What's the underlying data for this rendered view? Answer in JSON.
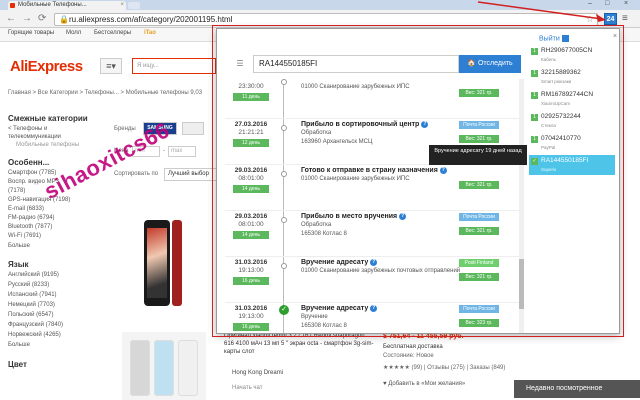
{
  "browser": {
    "tab_title": "Мобильные Телефоны...",
    "tab_close": "×",
    "url": "ru.aliexpress.com/af/category/202001195.html",
    "lock_icon": "lock-icon",
    "back": "←",
    "forward": "→",
    "reload": "⟳",
    "star": "☆",
    "extension_badge": "24",
    "menu": "≡",
    "minimize": "–",
    "maximize": "□",
    "close": "×"
  },
  "bookmarks": [
    "Горящие товары",
    "Молл",
    "Бестселлеры",
    "iTao"
  ],
  "ae": {
    "logo": "AliExpress",
    "menu_glyph": "≡▾",
    "search_placeholder": "Я ищу...",
    "breadcrumb": "Главная > Все Категории > Телефоны... > Мобильные телефоны 9,03",
    "related_title": "Смежные категории",
    "related_items": [
      "< Телефоны и",
      "телекоммуникации",
      "Мобильные телефоны"
    ],
    "features_title": "Особенн...",
    "features": [
      "Смартфон (7785)",
      "Воспр. видео MP3",
      "(7178)",
      "GPS-навигация (7198)",
      "E-mail (6833)",
      "FM-радио (6794)",
      "Bluetooth (7877)",
      "Wi-Fi (7691)"
    ],
    "more": "Больше",
    "lang_title": "Язык",
    "langs": [
      "Английский (9195)",
      "Русский (8233)",
      "Испанский (7941)",
      "Немецкий (7703)",
      "Польский (6547)",
      "Французский (7840)",
      "Норвежский (4265)"
    ],
    "more2": "Больше",
    "color_title": "Цвет",
    "brands_label": "Бренды",
    "brand_chip": "SAMSUNG",
    "price_label": "Цена",
    "price_min": "min",
    "price_dash": "-",
    "price_max": "max",
    "sort_label": "Сортировать по",
    "sort_value": "Лучший выбор",
    "listing": {
      "title": "Оригинал xiaomi redmi 3 2 / 16 г Redmi snapdragon 616 4100 мАч 13 мп 5 \" экран octa - смартфон 3g-sim-карты слот",
      "price": "$ 751,64 - 11 455,59 руб.",
      "shipping": "Бесплатная доставка",
      "condition": "Состояние: Новое",
      "rating": "★★★★★ (99) | Отзывы (275) | Заказы (849)",
      "favorite": "♥ Добавить в «Мои желания»",
      "store": "Hong Kong Dreami",
      "chat": "Начать чат"
    },
    "recent": "Недавно посмотренное"
  },
  "watermark": "sihaoxitcs66",
  "popup": {
    "close": "×",
    "input_value": "RA144550185FI",
    "track_btn": "🏠 Отследить",
    "exit": "Выйти",
    "tooltip": "Вручение адресату 19 дней назад",
    "events": [
      {
        "date": "",
        "time": "23:30:00",
        "days": "11 день",
        "title": "",
        "sub": "01000 Сканирование зарубежных ИПС",
        "addr": "",
        "carrier": "",
        "weight": "Вес: 321 гр.",
        "done": false
      },
      {
        "date": "27.03.2016",
        "time": "21:21:21",
        "days": "12 день",
        "title": "Прибыло в сортировочный центр",
        "sub": "Обработка",
        "addr": "163960 Архангельск МСЦ",
        "carrier": "Почта России",
        "weight": "Вес: 321 гр.",
        "done": false
      },
      {
        "date": "29.03.2016",
        "time": "08:01:00",
        "days": "14 день",
        "title": "Готово к отправке в страну назначения",
        "sub": "01000 Сканирование зарубежных ИПС",
        "addr": "",
        "carrier": "",
        "weight": "Вес: 321 гр.",
        "done": false
      },
      {
        "date": "29.03.2016",
        "time": "08:01:00",
        "days": "14 день",
        "title": "Прибыло в место вручения",
        "sub": "Обработка",
        "addr": "165308 Котлас 8",
        "carrier": "Почта России",
        "weight": "Вес: 321 гр.",
        "done": false
      },
      {
        "date": "31.03.2016",
        "time": "19:13:00",
        "days": "16 день",
        "title": "Вручение адресату",
        "sub": "01000 Сканирование зарубежных почтовых отправлений",
        "addr": "",
        "carrier": "Posti Finland",
        "weight": "Вес: 321 гр.",
        "done": false
      },
      {
        "date": "31.03.2016",
        "time": "19:13:00",
        "days": "16 день",
        "title": "Вручение адресату",
        "sub": "Вручение",
        "addr": "165308 Котлас 8",
        "carrier": "Почта России",
        "weight": "Вес: 323 гр.",
        "done": true
      }
    ],
    "tracks": [
      {
        "num": "1",
        "code": "RH290677005CN",
        "sub": "Кабель"
      },
      {
        "num": "1",
        "code": "32215889362",
        "sub": "Smart рюкзаки"
      },
      {
        "num": "1",
        "code": "RM167892744CN",
        "sub": "XiaomiUpCam"
      },
      {
        "num": "1",
        "code": "02925732244",
        "sub": "Стекла"
      },
      {
        "num": "1",
        "code": "07042410770",
        "sub": "PayPal"
      },
      {
        "num": "✓",
        "code": "RA144550185FI",
        "sub": "Superis"
      }
    ]
  },
  "colors": {
    "aliexpress_red": "#e62e04",
    "accent_blue": "#2d7fd3",
    "green": "#5cb85c",
    "annotation_red": "#d02020",
    "active_track": "#4dc4e8"
  }
}
